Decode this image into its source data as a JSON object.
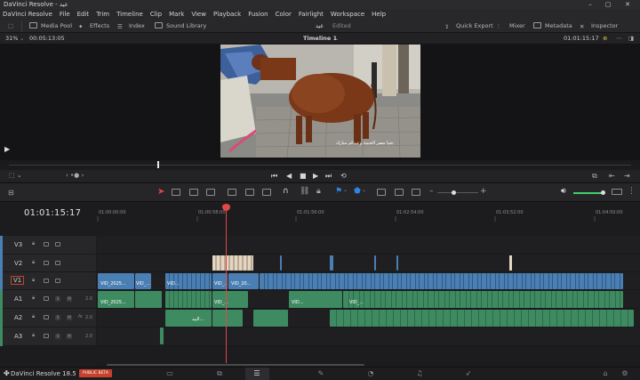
{
  "window": {
    "title": "DaVinci Resolve - عيد",
    "controls": [
      "–",
      "▢",
      "✕"
    ]
  },
  "menu": [
    "DaVinci Resolve",
    "File",
    "Edit",
    "Trim",
    "Timeline",
    "Clip",
    "Mark",
    "View",
    "Playback",
    "Fusion",
    "Color",
    "Fairlight",
    "Workspace",
    "Help"
  ],
  "toolbar": {
    "media_pool": "Media Pool",
    "effects": "Effects",
    "index": "Index",
    "sound_library": "Sound Library",
    "project_name": "عيد",
    "project_status": "Edited",
    "quick_export": "Quick Export",
    "mixer": "Mixer",
    "metadata": "Metadata",
    "inspector": "Inspector"
  },
  "viewer": {
    "zoom": "31%",
    "duration": "00:05:13:05",
    "timeline_name": "Timeline 1",
    "timecode": "01:01:15:17",
    "subtitle_text": "تحيا مصر الحبيبة وعيدكم مبارك"
  },
  "timeline": {
    "timecode": "01:01:15:17",
    "ruler_labels": [
      "01:00:00:00",
      "01:00:58:00",
      "01:01:56:00",
      "01:02:54:00",
      "01:03:52:00",
      "01:04:50:00"
    ],
    "tracks": [
      {
        "id": "V3",
        "kind": "video"
      },
      {
        "id": "V2",
        "kind": "video"
      },
      {
        "id": "V1",
        "kind": "video"
      },
      {
        "id": "A1",
        "kind": "audio",
        "level": "2.0"
      },
      {
        "id": "A2",
        "kind": "audio",
        "level": "2.0"
      },
      {
        "id": "A3",
        "kind": "audio",
        "level": "2.0"
      }
    ],
    "clip_labels": {
      "v1_first": "VID_2025...",
      "v1_second": "VID_...",
      "v1_third": "VID...",
      "v1_fourth": "VID_...",
      "v1_fifth": "VID_20...",
      "a1_first": "VID_2025...",
      "a1_second": "VID_...",
      "a1_third": "VID...",
      "a1_fourth": "VID_...",
      "a2_first": "البيد..."
    },
    "audio_icon_label": "S",
    "mute_label": "M",
    "fx_label": "fx"
  },
  "footer": {
    "app": "DaVinci Resolve 18.5",
    "badge": "PUBLIC BETA"
  },
  "colors": {
    "video_clip": "#4a7fb4",
    "audio_clip": "#3e8b62",
    "playhead": "#e04848",
    "volume": "#3fcf6a",
    "flag": "#2f86e0"
  }
}
